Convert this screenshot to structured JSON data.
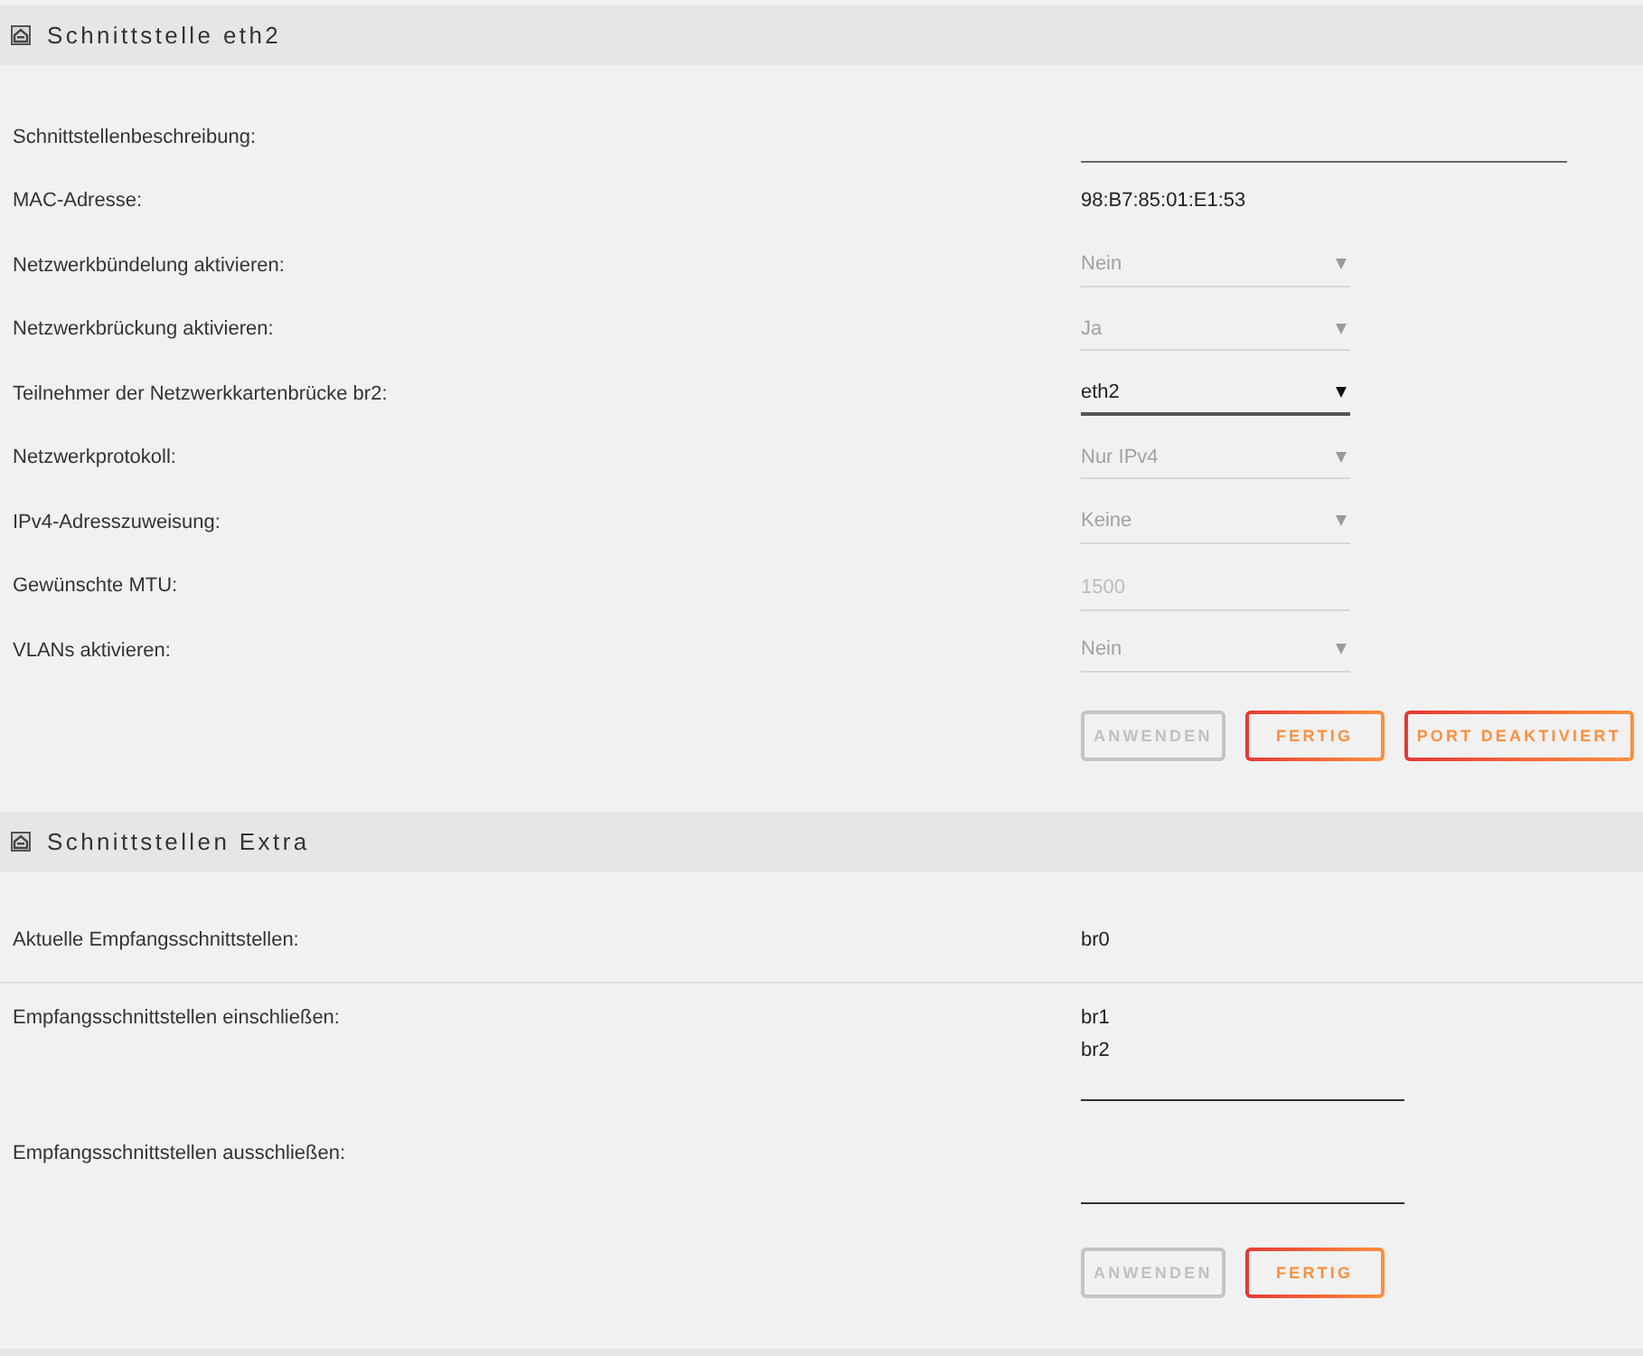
{
  "sections": [
    {
      "title": "Schnittstelle eth2",
      "rows": [
        {
          "label": "Schnittstellenbeschreibung:",
          "kind": "text_input",
          "disabled": false
        },
        {
          "label": "MAC-Adresse:",
          "kind": "text",
          "value": "98:B7:85:01:E1:53"
        },
        {
          "label": "Netzwerkbündelung aktivieren:",
          "kind": "select",
          "value": "Nein",
          "disabled": true
        },
        {
          "label": "Netzwerkbrückung aktivieren:",
          "kind": "select",
          "value": "Ja",
          "disabled": true
        },
        {
          "label": "Teilnehmer der Netzwerkkartenbrücke br2:",
          "kind": "select",
          "value": "eth2",
          "disabled": false
        },
        {
          "label": "Netzwerkprotokoll:",
          "kind": "select",
          "value": "Nur IPv4",
          "disabled": true
        },
        {
          "label": "IPv4-Adresszuweisung:",
          "kind": "select",
          "value": "Keine",
          "disabled": true
        },
        {
          "label": "Gewünschte MTU:",
          "kind": "number_input",
          "placeholder": "1500",
          "disabled": true
        },
        {
          "label": "VLANs aktivieren:",
          "kind": "select",
          "value": "Nein",
          "disabled": true
        }
      ],
      "buttons": [
        {
          "label": "ANWENDEN",
          "disabled": true
        },
        {
          "label": "FERTIG",
          "disabled": false
        },
        {
          "label": "PORT DEAKTIVIERT",
          "disabled": false
        }
      ]
    },
    {
      "title": "Schnittstellen Extra",
      "rows": [
        {
          "label": "Aktuelle Empfangsschnittstellen:",
          "kind": "text",
          "value": "br0",
          "divider": true
        },
        {
          "label": "Empfangsschnittstellen einschließen:",
          "kind": "list_input",
          "values": [
            "br1",
            "br2"
          ]
        },
        {
          "label": "Empfangsschnittstellen ausschließen:",
          "kind": "list_input"
        }
      ],
      "buttons": [
        {
          "label": "ANWENDEN",
          "disabled": true
        },
        {
          "label": "FERTIG",
          "disabled": false
        }
      ]
    }
  ]
}
